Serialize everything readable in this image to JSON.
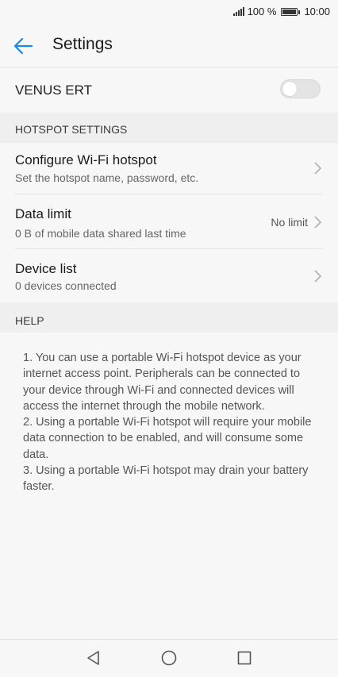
{
  "status_bar": {
    "battery_text": "100 %",
    "time": "10:00",
    "battery_level": 1.0
  },
  "app_bar": {
    "title": "Settings",
    "back_icon": "arrow-left-icon",
    "accent_color": "#1e88e5"
  },
  "hotspot": {
    "name": "VENUS ERT",
    "enabled": false
  },
  "hotspot_settings": {
    "header": "HOTSPOT SETTINGS",
    "items": [
      {
        "title": "Configure Wi-Fi hotspot",
        "subtitle": "Set the hotspot name, password, etc.",
        "value": ""
      },
      {
        "title": "Data limit",
        "subtitle": "0 B of mobile data shared last time",
        "value": "No limit"
      },
      {
        "title": "Device list",
        "subtitle": "0 devices connected",
        "value": ""
      }
    ]
  },
  "help": {
    "header": "HELP",
    "paragraphs": [
      "1. You can use a portable Wi-Fi hotspot device as your internet access point. Peripherals can be connected to your device through Wi-Fi and connected devices will access the internet through the mobile network.",
      "2. Using a portable Wi-Fi hotspot will require your mobile data connection to be enabled, and will consume some data.",
      "3. Using a portable Wi-Fi hotspot may drain your battery faster."
    ]
  },
  "nav": {
    "back_icon": "triangle-back-icon",
    "home_icon": "circle-home-icon",
    "recents_icon": "square-recents-icon"
  }
}
